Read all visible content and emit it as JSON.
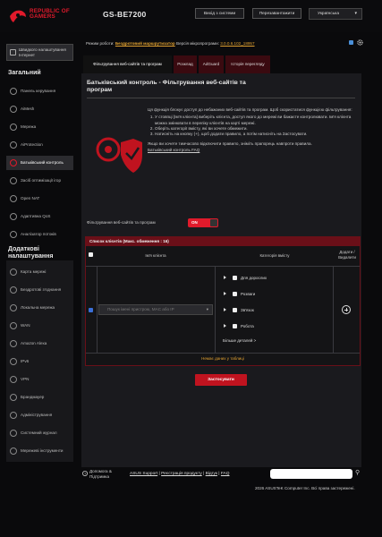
{
  "header": {
    "brand_line1": "REPUBLIC OF",
    "brand_line2": "GAMERS",
    "model": "GS-BE7200",
    "logout_label": "Вихід з системи",
    "reboot_label": "Перезавантажити",
    "language": "Українська"
  },
  "sidebar": {
    "quick_setup": "Швидкого налаштування Інтернет",
    "general_title": "Загальний",
    "general_items": [
      {
        "label": "Панель керування",
        "icon": "dashboard-icon"
      },
      {
        "label": "AiMesh",
        "icon": "aimesh-icon"
      },
      {
        "label": "Мережа",
        "icon": "network-icon"
      },
      {
        "label": "AiProtection",
        "icon": "shield-icon"
      },
      {
        "label": "Батьківський контроль",
        "icon": "parental-icon"
      },
      {
        "label": "Засіб оптимізації ігор",
        "icon": "game-icon"
      },
      {
        "label": "Open NAT",
        "icon": "nat-icon"
      },
      {
        "label": "Адаптивна QoS",
        "icon": "qos-icon"
      },
      {
        "label": "Аналізатор потоків",
        "icon": "traffic-icon"
      }
    ],
    "advanced_title": "Додаткові налаштування",
    "advanced_items": [
      {
        "label": "Карта мережі",
        "icon": "map-icon"
      },
      {
        "label": "Бездротові з'єднання",
        "icon": "wireless-icon"
      },
      {
        "label": "Локальна мережа",
        "icon": "lan-icon"
      },
      {
        "label": "WAN",
        "icon": "globe-icon"
      },
      {
        "label": "Amazon Alexa",
        "icon": "alexa-icon"
      },
      {
        "label": "IPv6",
        "icon": "ipv6-icon"
      },
      {
        "label": "VPN",
        "icon": "vpn-icon"
      },
      {
        "label": "Брандмауер",
        "icon": "firewall-icon"
      },
      {
        "label": "Адміністрування",
        "icon": "admin-icon"
      },
      {
        "label": "Системний журнал",
        "icon": "log-icon"
      },
      {
        "label": "Мережеві інструменти",
        "icon": "tools-icon"
      }
    ]
  },
  "topinfo": {
    "mode_label": "Режим роботи:",
    "mode_value": "Бездротовий маршрутизатор",
    "fw_label": "Версія мікропрограми:",
    "fw_value": "3.0.0.6.102_18957"
  },
  "tabs": [
    {
      "label": "Фільтрування веб-сайтів та програм"
    },
    {
      "label": "Розклад"
    },
    {
      "label": "AdGuard"
    },
    {
      "label": "Історія перегляду"
    }
  ],
  "panel": {
    "title": "Батьківський контроль - Фільтрування веб-сайтів та програм",
    "intro": "Ця функція блокує доступ до небажаних веб-сайтів та програм. Щоб скористатися функцією фільтрування:",
    "steps": [
      "У стовпці [Ім'я клієнта] виберіть клієнта, доступ якого до мережі ви бажаєте контролювати. Ім'я клієнта можна змінювати в переліку клієнтів на карті мережі.",
      "Оберіть категорії вмісту, які ви хочете обмежити.",
      "Натисніть на кнопку (+), щоб додати правило, а потім натисніть на Застосувати."
    ],
    "disable_note": "Якщо ви хочете тимчасово відключити правило, зніміть прапорець навпроти правила.",
    "faq_link": "Батьківський контроль FAQ",
    "toggle_label": "Фільтрування веб-сайтів та програм",
    "toggle_state": "ON"
  },
  "table": {
    "title": "Список клієнтів (Макс. обмеження : 16)",
    "col_client": "Ім'я клієнта",
    "col_category": "Категорія вмісту",
    "col_addremove": "Додати / Видалити",
    "input_placeholder": "Пошук імені пристрою, MAC або IP",
    "categories": [
      "Для дорослих",
      "Розваги",
      "Зв'язок",
      "Робота"
    ],
    "more": "Більше деталей >",
    "no_data": "Немає даних у таблиці"
  },
  "apply_label": "Застосувати",
  "footer": {
    "help_line1": "Допомога &",
    "help_line2": "Підтримка",
    "links": [
      "ASUS Support",
      "Реєстрація продукту",
      "Відгук",
      "FAQ"
    ],
    "copyright": "2026 ASUSTeK Computer Inc. Всі права застережені."
  },
  "colors": {
    "accent": "#e01a2b",
    "highlight": "#e0a030"
  }
}
